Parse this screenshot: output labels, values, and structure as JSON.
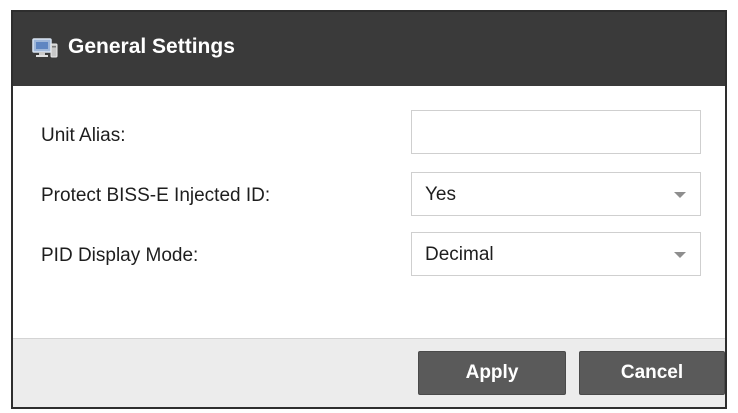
{
  "dialog": {
    "title": "General Settings",
    "icon": "computer-monitor-icon"
  },
  "fields": {
    "unit_alias": {
      "label": "Unit Alias:",
      "value": "",
      "placeholder": ""
    },
    "protect_biss": {
      "label": "Protect BISS-E Injected ID:",
      "selected": "Yes"
    },
    "pid_display": {
      "label": "PID Display Mode:",
      "selected": "Decimal"
    }
  },
  "buttons": {
    "apply_label": "Apply",
    "cancel_label": "Cancel"
  },
  "colors": {
    "titlebar": "#3a3a3a",
    "button": "#5a5a5a",
    "footer": "#ececec"
  }
}
